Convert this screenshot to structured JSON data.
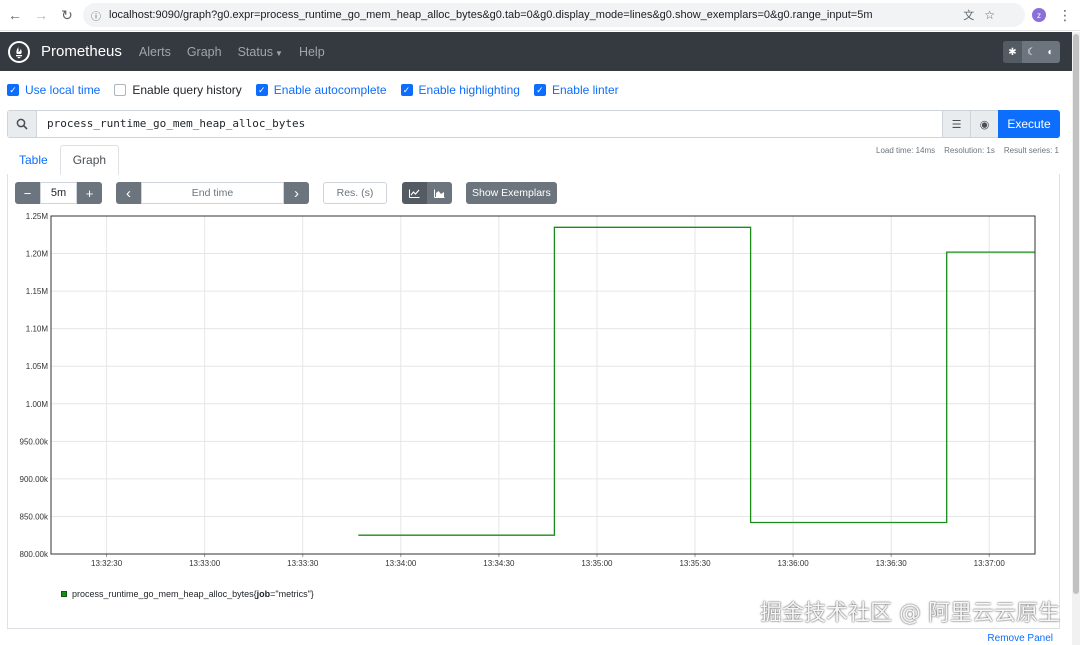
{
  "browser": {
    "url": "localhost:9090/graph?g0.expr=process_runtime_go_mem_heap_alloc_bytes&g0.tab=0&g0.display_mode=lines&g0.show_exemplars=0&g0.range_input=5m",
    "avatar_letter": "z"
  },
  "navbar": {
    "brand": "Prometheus",
    "items": [
      "Alerts",
      "Graph",
      "Status",
      "Help"
    ]
  },
  "options": [
    {
      "label": "Use local time",
      "checked": true
    },
    {
      "label": "Enable query history",
      "checked": false
    },
    {
      "label": "Enable autocomplete",
      "checked": true
    },
    {
      "label": "Enable highlighting",
      "checked": true
    },
    {
      "label": "Enable linter",
      "checked": true
    }
  ],
  "query": {
    "expression": "process_runtime_go_mem_heap_alloc_bytes",
    "execute_label": "Execute"
  },
  "tabs": {
    "table": "Table",
    "graph": "Graph",
    "active": "graph"
  },
  "stats": {
    "load_time": "Load time: 14ms",
    "resolution": "Resolution: 1s",
    "result_series": "Result series: 1"
  },
  "controls": {
    "minus": "−",
    "range": "5m",
    "plus": "+",
    "prev": "‹",
    "end_time_placeholder": "End time",
    "next": "›",
    "res_placeholder": "Res. (s)",
    "exemplars_label": "Show Exemplars"
  },
  "chart_data": {
    "type": "line",
    "x_ticks": [
      "13:32:30",
      "13:33:00",
      "13:33:30",
      "13:34:00",
      "13:34:30",
      "13:35:00",
      "13:35:30",
      "13:36:00",
      "13:36:30",
      "13:37:00"
    ],
    "y_ticks": [
      "800.00k",
      "850.00k",
      "900.00k",
      "950.00k",
      "1.00M",
      "1.05M",
      "1.10M",
      "1.15M",
      "1.20M",
      "1.25M"
    ],
    "ylim": [
      800000,
      1250000
    ],
    "xlim_seconds_from_133230": [
      -17,
      284
    ],
    "series": [
      {
        "name": "process_runtime_go_mem_heap_alloc_bytes{job=\"metrics\"}",
        "color": "#1a8c1a",
        "points": [
          [
            77,
            825000
          ],
          [
            137,
            825000
          ],
          [
            137,
            1235000
          ],
          [
            197,
            1235000
          ],
          [
            197,
            842000
          ],
          [
            257,
            842000
          ],
          [
            257,
            1202000
          ],
          [
            284,
            1202000
          ]
        ]
      }
    ]
  },
  "legend": {
    "metric": "process_runtime_go_mem_heap_alloc_bytes",
    "label_open": "{",
    "label_key": "job",
    "label_eq": "=",
    "label_value": "\"metrics\"",
    "label_close": "}"
  },
  "remove_panel": "Remove Panel",
  "watermark": "掘金技术社区 @ 阿里云云原生"
}
